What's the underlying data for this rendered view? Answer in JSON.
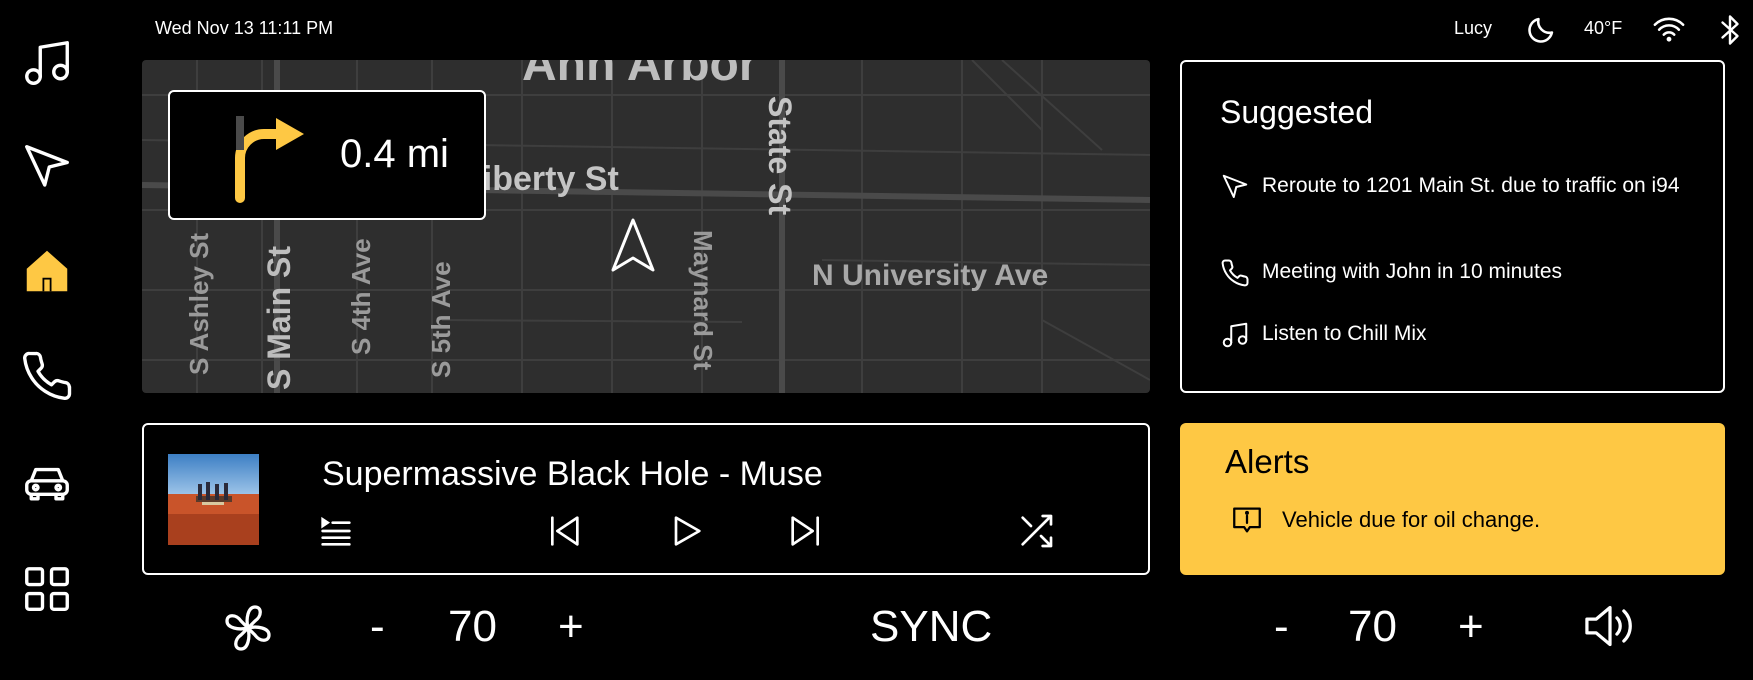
{
  "status": {
    "datetime": "Wed Nov 13  11:11 PM",
    "user": "Lucy",
    "temperature": "40°F"
  },
  "sidebar": {
    "items": [
      {
        "name": "music",
        "icon": "music-icon"
      },
      {
        "name": "navigation",
        "icon": "navigation-icon"
      },
      {
        "name": "home",
        "icon": "home-icon",
        "active": true
      },
      {
        "name": "phone",
        "icon": "phone-icon"
      },
      {
        "name": "vehicle",
        "icon": "car-icon"
      },
      {
        "name": "apps",
        "icon": "grid-icon"
      }
    ]
  },
  "map": {
    "turn_distance": "0.4 mi",
    "city_label": "Ann Arbor",
    "streets": [
      "Liberty St",
      "State St",
      "N University Ave",
      "S Ashley St",
      "S Main St",
      "S 4th Ave",
      "S 5th Ave",
      "Maynard St"
    ]
  },
  "suggested": {
    "title": "Suggested",
    "items": [
      {
        "icon": "navigation-icon",
        "text": "Reroute to 1201 Main St. due to traffic on i94"
      },
      {
        "icon": "phone-icon",
        "text": "Meeting with John in 10 minutes"
      },
      {
        "icon": "music-icon",
        "text": "Listen to Chill Mix"
      }
    ]
  },
  "player": {
    "track": "Supermassive Black Hole - Muse"
  },
  "alerts": {
    "title": "Alerts",
    "items": [
      {
        "icon": "alert-message-icon",
        "text": "Vehicle due for oil change."
      }
    ]
  },
  "climate": {
    "left_minus": "-",
    "left_temp": "70",
    "left_plus": "+",
    "sync_label": "SYNC",
    "right_minus": "-",
    "right_temp": "70",
    "right_plus": "+"
  },
  "colors": {
    "accent": "#fec844",
    "background": "#000000",
    "map_bg": "#2e2e2e"
  }
}
